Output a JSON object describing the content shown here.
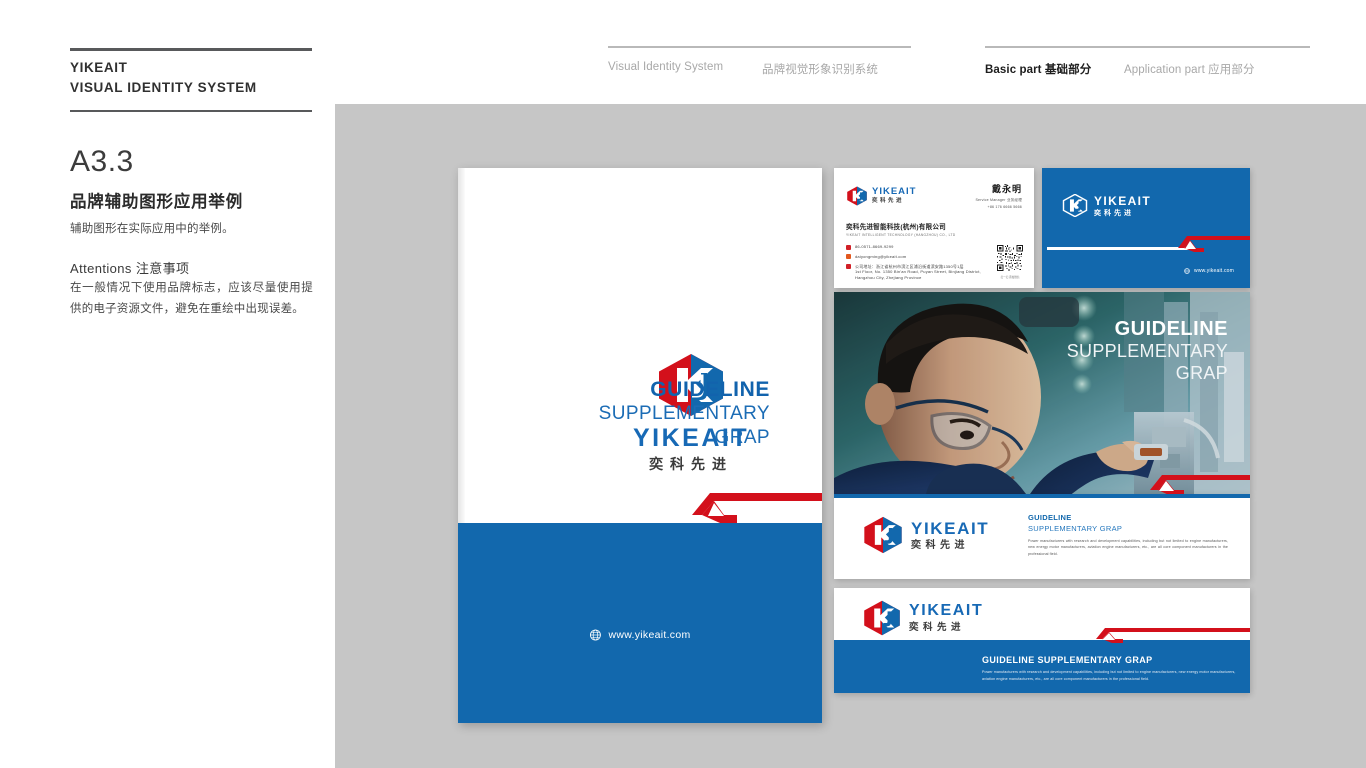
{
  "header": {
    "brand_name": "YIKEAIT",
    "brand_subtitle": "VISUAL IDENTITY SYSTEM",
    "nav_left": [
      {
        "label": "Visual Identity System"
      },
      {
        "label": "品牌视觉形象识别系统"
      }
    ],
    "nav_right": [
      {
        "label_en": "Basic part",
        "label_cn": "基础部分",
        "active": true
      },
      {
        "label_en": "Application part",
        "label_cn": "应用部分",
        "active": false
      }
    ]
  },
  "sidebar": {
    "section_code": "A3.3",
    "section_title": "品牌辅助图形应用举例",
    "section_desc": "辅助图形在实际应用中的举例。",
    "attentions_title": "Attentions 注意事项",
    "attentions_body": "在一般情况下使用品牌标志，应该尽量使用提供的电子资源文件，避免在重绘中出现误差。"
  },
  "logo": {
    "latin": "YIKEAIT",
    "cn": "奕科先进",
    "red": "#d3101b",
    "blue": "#1268ad"
  },
  "cover": {
    "headline": "GUIDELINE",
    "subline_1": "SUPPLEMENTARY",
    "subline_2": "GRAP",
    "url": "www.yikeait.com",
    "globe_icon": "globe-icon"
  },
  "business_card": {
    "name": "戴永明",
    "role": "Service Manager  业务经理",
    "phone": "+86 176 6666 5666",
    "company_cn": "奕科先进智能科技(杭州)有限公司",
    "company_en": "YIKEAIT INTELLIGENT TECHNOLOGY (HANGZHOU) CO., LTD",
    "contact_lines": [
      {
        "icon": "phone-icon",
        "text": "86-0571-8669-9299"
      },
      {
        "icon": "mail-icon",
        "text": "daiyongming@yikeait.com"
      },
      {
        "icon": "location-icon",
        "text": "公司地址：浙江省杭州市滨江区浦沿街道滨安路1350号1层\n1st Floor, No. 1350 Bin'an Road, Puyan Street, Binjiang District,\nHangzhou City, Zhejiang Province"
      }
    ],
    "qr_caption": "扫一扫 添加微信"
  },
  "blue_card": {
    "url": "www.yikeait.com",
    "globe_icon": "globe-icon"
  },
  "photo_banner": {
    "headline": "GUIDELINE",
    "subline_1": "SUPPLEMENTARY",
    "subline_2": "GRAP",
    "alt": "technician-inspecting-machinery-photo"
  },
  "info_card": {
    "headline": "GUIDELINE",
    "subline": "SUPPLEMENTARY GRAP",
    "body": "Power manufacturers with research and development capabilities, including but not limited to engine manufacturers, new energy motor manufacturers, aviation engine manufacturers, etc., are all core component manufacturers in the professional field."
  },
  "bottom_banner": {
    "headline": "GUIDELINE SUPPLEMENTARY GRAP",
    "body": "Power manufacturers with research and development capabilities, including but not limited to engine manufacturers, new energy motor manufacturers, aviation engine manufacturers, etc., are all core component manufacturers in the professional field."
  },
  "colors": {
    "brand_blue": "#1268ad",
    "brand_red": "#d3101b",
    "canvas_grey": "#c6c6c6"
  }
}
